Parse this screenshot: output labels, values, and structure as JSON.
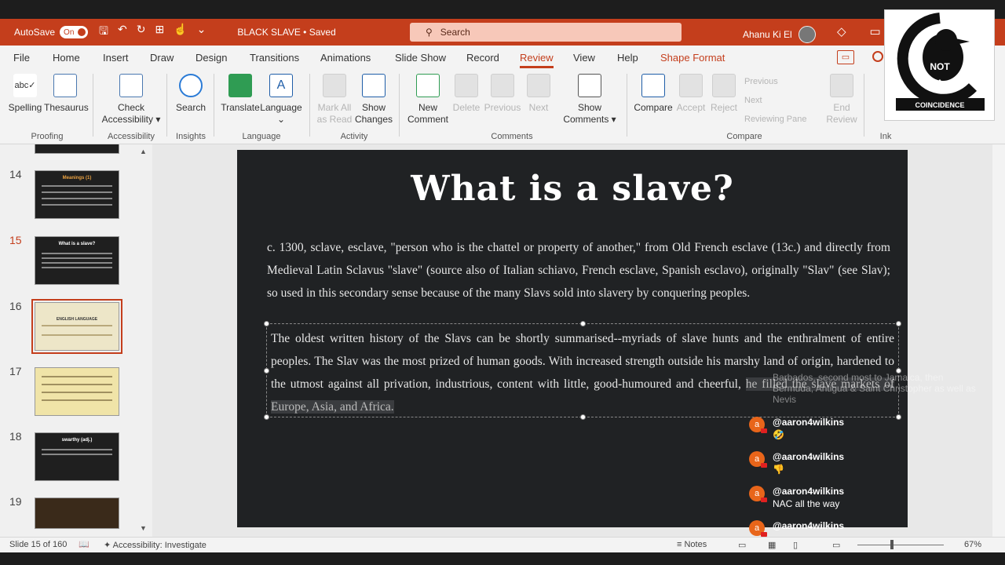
{
  "titlebar": {
    "autosave_label": "AutoSave",
    "autosave_state": "On",
    "doc_title": "BLACK SLAVE • Saved",
    "search_placeholder": "Search",
    "user_name": "Ahanu Ki El"
  },
  "tabs": [
    "File",
    "Home",
    "Insert",
    "Draw",
    "Design",
    "Transitions",
    "Animations",
    "Slide Show",
    "Record",
    "Review",
    "View",
    "Help",
    "Shape Format"
  ],
  "active_tab": "Review",
  "ribbon": {
    "spelling": "Spelling",
    "thesaurus": "Thesaurus",
    "check": "Check",
    "accessibility": "Accessibility ▾",
    "search": "Search",
    "translate": "Translate",
    "language": "Language",
    "mark_all": "Mark All",
    "as_read": "as Read",
    "show": "Show",
    "changes": "Changes",
    "new": "New",
    "comment": "Comment",
    "delete": "Delete",
    "previous": "Previous",
    "next": "Next",
    "show2": "Show",
    "comments": "Comments ▾",
    "compare": "Compare",
    "accept": "Accept",
    "reject": "Reject",
    "prev_small": "Previous",
    "next_small": "Next",
    "reviewing_pane": "Reviewing Pane",
    "end": "End",
    "review": "Review",
    "groups": {
      "proofing": "Proofing",
      "accessibility": "Accessibility",
      "insights": "Insights",
      "language": "Language",
      "activity": "Activity",
      "comments": "Comments",
      "compare": "Compare",
      "ink": "Ink"
    }
  },
  "thumbnails": [
    {
      "num": "14",
      "title": "Meanings (1)"
    },
    {
      "num": "15",
      "title": "What is a slave?"
    },
    {
      "num": "16",
      "title": "ENGLISH LANGUAGE"
    },
    {
      "num": "17",
      "title": ""
    },
    {
      "num": "18",
      "title": "swarthy (adj.)"
    },
    {
      "num": "19",
      "title": ""
    }
  ],
  "slide": {
    "title": "What is a slave?",
    "para1": "c. 1300, sclave, esclave, \"person who is the chattel or property of another,\" from Old French esclave (13c.) and directly from Medieval Latin Sclavus \"slave\" (source also of Italian schiavo, French esclave, Spanish esclavo), originally \"Slav\" (see Slav); so used in this secondary sense because of the many Slavs sold into slavery by conquering peoples.",
    "para2_main": "The oldest written history of the Slavs can be shortly summarised--myriads of slave hunts and the enthralment of entire peoples. The Slav was the most prized of human goods. With increased strength outside his marshy land of origin, hardened to the utmost against all privation, industrious, content with little, good-humoured and cheerful,",
    "para2_highlight": "he filled the slave markets of Europe, Asia, and Africa."
  },
  "chat": {
    "ghost": "Barbados, second most to Jamaica, then Bermuda, Antigua & Saint Christopher as well as Nevis",
    "messages": [
      {
        "user": "@aaron4wilkins",
        "text": "🤣"
      },
      {
        "user": "@aaron4wilkins",
        "text": "👎"
      },
      {
        "user": "@aaron4wilkins",
        "text": "NAC all the way"
      },
      {
        "user": "@aaron4wilkins",
        "text": ""
      }
    ]
  },
  "logo": {
    "line1": "NOT",
    "line2": "A",
    "line3": "COINCIDENCE"
  },
  "status": {
    "slide_of": "Slide 15 of 160",
    "accessibility": "Accessibility: Investigate",
    "notes": "Notes",
    "zoom": "67%"
  }
}
